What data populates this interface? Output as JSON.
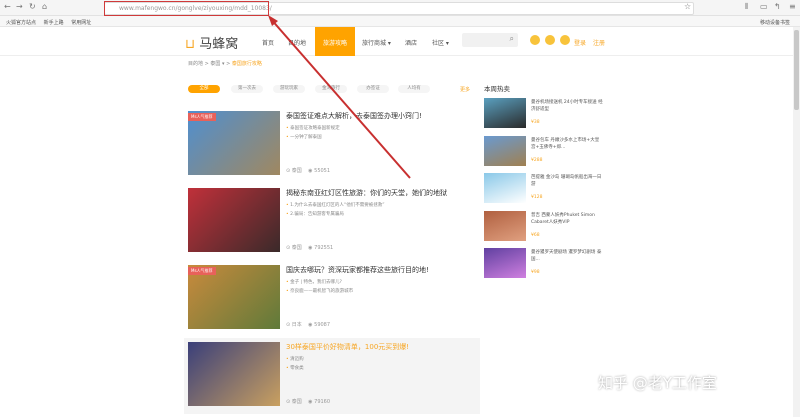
{
  "browser": {
    "url": "www.mafengwo.cn/gonglve/ziyouxing/mdd_10083/",
    "bookmarks": [
      "火狐官方站点",
      "新手上路",
      "常用网址"
    ],
    "bookmarks_right": "移动设备书签"
  },
  "site": {
    "logo": "马蜂窝",
    "nav": [
      "首页",
      "目的地",
      "旅游攻略",
      "旅行商城 ▾",
      "酒店",
      "社区 ▾"
    ],
    "active_nav": "旅游攻略",
    "login": "登录",
    "register": "注册"
  },
  "breadcrumb": [
    "目的地",
    "泰国 ▾",
    "泰国旅行攻略"
  ],
  "filters": [
    "全部",
    "第一次去",
    "游玩玩家",
    "金湾旅行",
    "办签证",
    "人均有"
  ],
  "filters_more": "更多",
  "articles": [
    {
      "tag": "Ms人气推荐",
      "title": "泰国签证难点大解析，去泰国签办理小窍门!",
      "bullets": [
        "泰国签证攻略泰国新规定",
        "一分钟了解泰国"
      ],
      "place": "泰国",
      "views": "55051",
      "colors": [
        "#4f8fd0",
        "#a08860"
      ]
    },
    {
      "tag": "",
      "title": "揭秘东南亚红灯区性旅游：你们的天堂，她们的地狱",
      "bullets": [
        "1.为什么去泰国红灯区的人“他们不需要被拯救”",
        "2.骗局：告知游客专属骗局"
      ],
      "place": "泰国",
      "views": "792551",
      "colors": [
        "#c0303a",
        "#3a2a2a"
      ]
    },
    {
      "tag": "Ms人气推荐",
      "title": "国庆去哪玩？资深玩家都推荐这些旅行目的地!",
      "bullets": [
        "金子 | 特色，我们去哪儿?",
        "奈良鹿——最机智飞的旅游城市"
      ],
      "place": "日本",
      "views": "59087",
      "colors": [
        "#c98a3c",
        "#5f7a3a"
      ]
    },
    {
      "tag": "",
      "title": "30样泰国平价好物清单，100元买到爆!",
      "bullets": [
        "清迈购",
        "零食类"
      ],
      "place": "泰国",
      "views": "79160",
      "colors": [
        "#3a3f7a",
        "#c9a060"
      ]
    }
  ],
  "sidebar": {
    "title": "本周热卖",
    "items": [
      {
        "title": "曼谷机场接送机 24小时专车接送 经济舒适型",
        "price": "¥38",
        "colors": [
          "#5aa0c0",
          "#2a2a2a"
        ]
      },
      {
        "title": "曼谷包车 丹嫩沙多水上市场+大皇宫+玉佛寺+郑...",
        "price": "¥288",
        "colors": [
          "#6a9ad0",
          "#a08050"
        ]
      },
      {
        "title": "芭提雅 金沙岛 珊瑚岛帆船出海一日游",
        "price": "¥128",
        "colors": [
          "#8ac8e8",
          "#ffffff"
        ]
      },
      {
        "title": "普吉 西蒙人妖秀Phuket Simon Cabaret人妖秀VIP",
        "price": "¥68",
        "colors": [
          "#b06040",
          "#e0a080"
        ]
      },
      {
        "title": "曼谷暹罗天使剧场 暹罗梦幻剧场 泰国...",
        "price": "¥98",
        "colors": [
          "#6040a0",
          "#d080e0"
        ]
      }
    ]
  },
  "watermark": "知乎 @老Y工作室"
}
